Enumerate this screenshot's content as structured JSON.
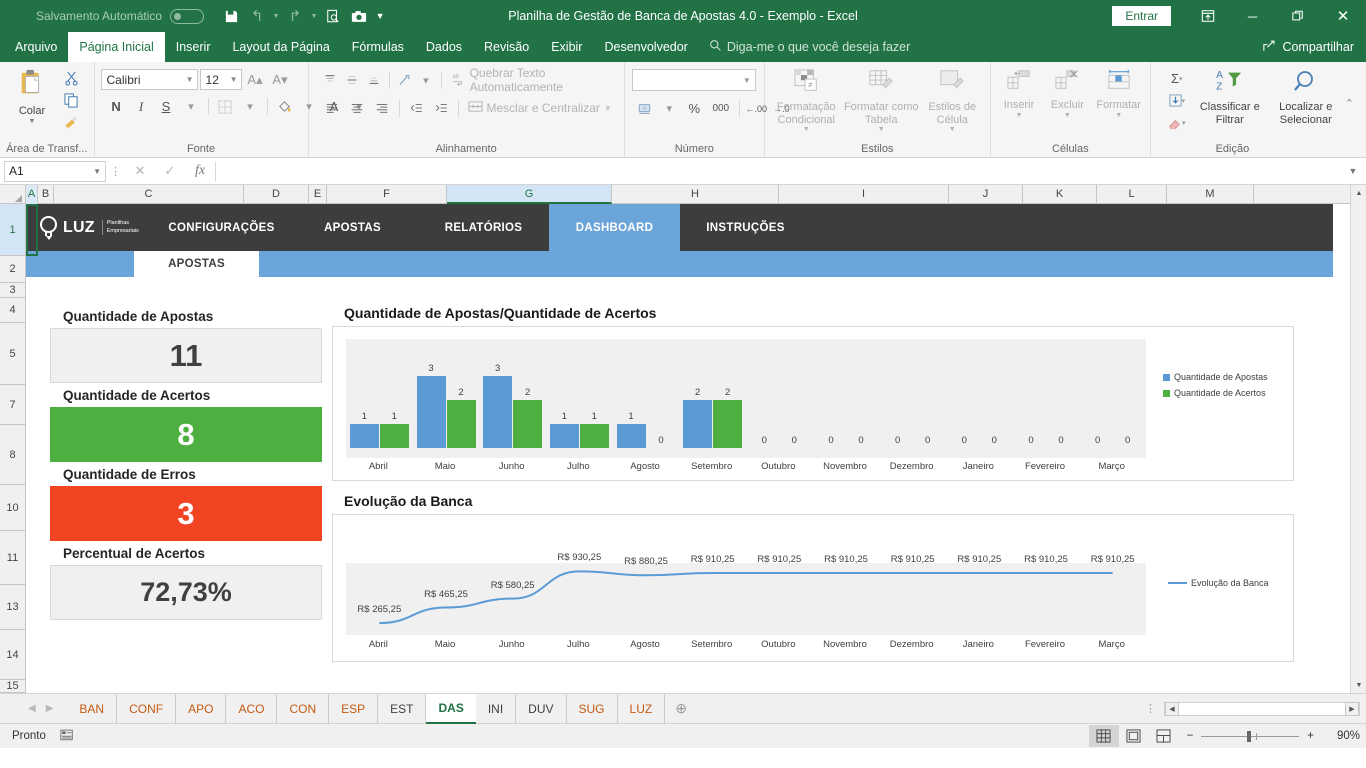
{
  "titlebar": {
    "autosave_label": "Salvamento Automático",
    "autosave_state": "off",
    "document_title": "Planilha de Gestão de Banca de Apostas 4.0 - Exemplo  -  Excel",
    "signin_label": "Entrar",
    "quick_access": [
      "save-icon",
      "undo-icon",
      "redo-icon",
      "print-preview-icon",
      "camera-icon",
      "customize-qat-icon"
    ]
  },
  "ribbon": {
    "tabs": [
      {
        "label": "Arquivo",
        "active": false
      },
      {
        "label": "Página Inicial",
        "active": true
      },
      {
        "label": "Inserir",
        "active": false
      },
      {
        "label": "Layout da Página",
        "active": false
      },
      {
        "label": "Fórmulas",
        "active": false
      },
      {
        "label": "Dados",
        "active": false
      },
      {
        "label": "Revisão",
        "active": false
      },
      {
        "label": "Exibir",
        "active": false
      },
      {
        "label": "Desenvolvedor",
        "active": false
      }
    ],
    "tellme": "Diga-me o que você deseja fazer",
    "share": "Compartilhar",
    "groups": {
      "clipboard": {
        "title": "Área de Transf...",
        "paste": "Colar",
        "cut": "cut-icon",
        "copy": "copy-icon",
        "format_painter": "format-painter-icon"
      },
      "font": {
        "title": "Fonte",
        "font_name": "Calibri",
        "font_size": "12",
        "bold": "N",
        "italic": "I",
        "underline": "S",
        "grow": "A",
        "shrink": "A",
        "borders": "borders-icon",
        "fill": "fill-color-icon",
        "fontcolor": "font-color-icon"
      },
      "alignment": {
        "title": "Alinhamento",
        "wrap_text": "Quebrar Texto Automaticamente",
        "merge_center": "Mesclar e Centralizar"
      },
      "number": {
        "title": "Número",
        "format_value": "",
        "accounting": "000",
        "percent": "%"
      },
      "styles": {
        "title": "Estilos",
        "conditional": "Formatação Condicional",
        "as_table": "Formatar como Tabela",
        "cell_styles": "Estilos de Célula"
      },
      "cells": {
        "title": "Células",
        "insert": "Inserir",
        "delete": "Excluir",
        "format": "Formatar"
      },
      "editing": {
        "title": "Edição",
        "sort_filter": "Classificar e Filtrar",
        "find_select": "Localizar e Selecionar"
      }
    }
  },
  "formulabar": {
    "namebox": "A1",
    "formula": ""
  },
  "grid": {
    "columns": [
      "A",
      "B",
      "C",
      "D",
      "E",
      "F",
      "G",
      "H",
      "I",
      "J",
      "K",
      "L",
      "M"
    ],
    "rows": [
      "1",
      "2",
      "3",
      "4",
      "5",
      "7",
      "8",
      "10",
      "11",
      "13",
      "14",
      "15"
    ]
  },
  "dashboard": {
    "brand": {
      "name": "LUZ",
      "tagline_line1": "Planilhas",
      "tagline_line2": "Empresariais"
    },
    "nav": [
      {
        "label": "CONFIGURAÇÕES",
        "active": false
      },
      {
        "label": "APOSTAS",
        "active": false
      },
      {
        "label": "RELATÓRIOS",
        "active": false
      },
      {
        "label": "DASHBOARD",
        "active": true
      },
      {
        "label": "INSTRUÇÕES",
        "active": false
      }
    ],
    "subtab": "APOSTAS",
    "kpis": [
      {
        "label": "Quantidade de Apostas",
        "value": "11",
        "style": "grey"
      },
      {
        "label": "Quantidade de Acertos",
        "value": "8",
        "style": "green"
      },
      {
        "label": "Quantidade de Erros",
        "value": "3",
        "style": "red"
      },
      {
        "label": "Percentual de Acertos",
        "value": "72,73%",
        "style": "grey"
      }
    ],
    "colors": {
      "green": "#4CAF3F",
      "red": "#F04423",
      "blue": "#5B9BD5",
      "navy": "#3D3D3D",
      "accent": "#6BA4D8"
    }
  },
  "chart_data": [
    {
      "type": "bar",
      "title": "Quantidade de Apostas/Quantidade de Acertos",
      "categories": [
        "Abril",
        "Maio",
        "Junho",
        "Julho",
        "Agosto",
        "Setembro",
        "Outubro",
        "Novembro",
        "Dezembro",
        "Janeiro",
        "Fevereiro",
        "Março"
      ],
      "series": [
        {
          "name": "Quantidade de Apostas",
          "color": "#5B9BD5",
          "values": [
            1,
            3,
            3,
            1,
            1,
            2,
            0,
            0,
            0,
            0,
            0,
            0
          ]
        },
        {
          "name": "Quantidade de Acertos",
          "color": "#4CAF3F",
          "values": [
            1,
            2,
            2,
            1,
            0,
            2,
            0,
            0,
            0,
            0,
            0,
            0
          ]
        }
      ],
      "xlabel": "",
      "ylabel": "",
      "ylim": [
        0,
        3
      ],
      "grid": false,
      "legend_position": "right",
      "data_labels": true
    },
    {
      "type": "line",
      "title": "Evolução da Banca",
      "categories": [
        "Abril",
        "Maio",
        "Junho",
        "Julho",
        "Agosto",
        "Setembro",
        "Outubro",
        "Novembro",
        "Dezembro",
        "Janeiro",
        "Fevereiro",
        "Março"
      ],
      "series": [
        {
          "name": "Evolução da Banca",
          "color": "#5B9BD5",
          "values": [
            265.25,
            465.25,
            580.25,
            930.25,
            880.25,
            910.25,
            910.25,
            910.25,
            910.25,
            910.25,
            910.25,
            910.25
          ],
          "labels": [
            "R$ 265,25",
            "R$ 465,25",
            "R$ 580,25",
            "R$ 930,25",
            "R$ 880,25",
            "R$ 910,25",
            "R$ 910,25",
            "R$ 910,25",
            "R$ 910,25",
            "R$ 910,25",
            "R$ 910,25",
            "R$ 910,25"
          ]
        }
      ],
      "xlabel": "",
      "ylabel": "",
      "ylim": [
        0,
        1000
      ],
      "grid": false,
      "legend_position": "right",
      "data_labels": true,
      "smooth": true
    }
  ],
  "sheettabs": {
    "tabs": [
      {
        "label": "BAN",
        "color": "#C55A11",
        "active": false
      },
      {
        "label": "CONF",
        "color": "#C55A11",
        "active": false
      },
      {
        "label": "APO",
        "color": "#C55A11",
        "active": false
      },
      {
        "label": "ACO",
        "color": "#C55A11",
        "active": false
      },
      {
        "label": "CON",
        "color": "#C55A11",
        "active": false
      },
      {
        "label": "ESP",
        "color": "#C55A11",
        "active": false
      },
      {
        "label": "EST",
        "color": "#404040",
        "active": false
      },
      {
        "label": "DAS",
        "color": "#217346",
        "active": true
      },
      {
        "label": "INI",
        "color": "#404040",
        "active": false
      },
      {
        "label": "DUV",
        "color": "#404040",
        "active": false
      },
      {
        "label": "SUG",
        "color": "#C55A11",
        "active": false
      },
      {
        "label": "LUZ",
        "color": "#C55A11",
        "active": false
      }
    ]
  },
  "statusbar": {
    "state": "Pronto",
    "zoom": "90%"
  }
}
